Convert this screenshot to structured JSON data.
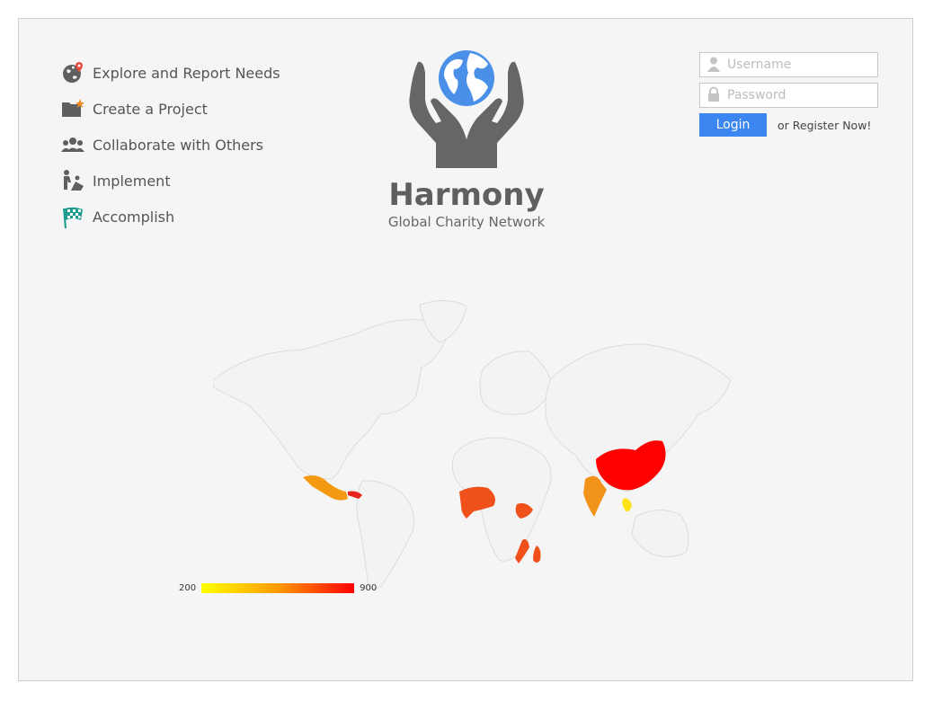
{
  "menu": {
    "items": [
      {
        "label": "Explore and Report Needs",
        "icon": "globe-pin-icon"
      },
      {
        "label": "Create a Project",
        "icon": "folder-star-icon"
      },
      {
        "label": "Collaborate with Others",
        "icon": "people-icon"
      },
      {
        "label": "Implement",
        "icon": "worker-icon"
      },
      {
        "label": "Accomplish",
        "icon": "checkered-flag-icon"
      }
    ]
  },
  "brand": {
    "title": "Harmony",
    "subtitle": "Global Charity Network",
    "logo": "hands-globe-logo"
  },
  "login": {
    "username_placeholder": "Username",
    "password_placeholder": "Password",
    "login_label": "Login",
    "register_label": "or Register Now!"
  },
  "map": {
    "legend_min": "200",
    "legend_max": "900",
    "scale_colors": [
      "#ffff00",
      "#ff9a00",
      "#ff0000"
    ],
    "highlighted_regions": [
      "Mexico",
      "Central America",
      "West Africa",
      "Ethiopia",
      "East Africa",
      "Madagascar",
      "India",
      "China",
      "Southeast Asia"
    ]
  },
  "colors": {
    "accent": "#3b86f0",
    "panel": "#f5f5f5",
    "icon_gray": "#5f5f5f",
    "globe_blue": "#4a8fe8"
  }
}
